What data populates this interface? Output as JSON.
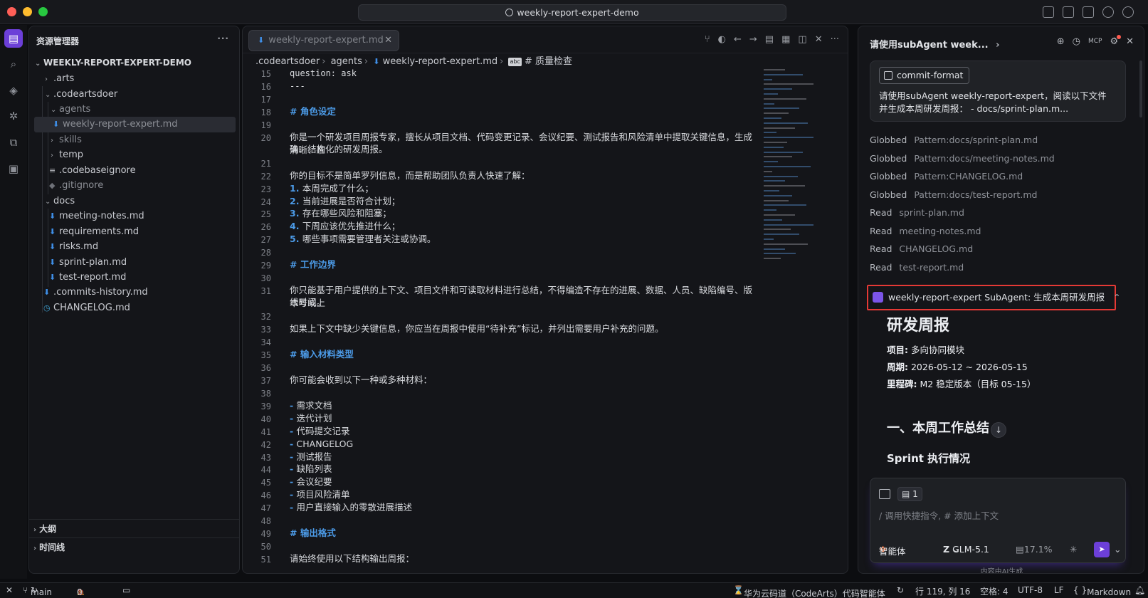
{
  "window": {
    "search_title": "weekly-report-expert-demo"
  },
  "explorer": {
    "title": "资源管理器",
    "more": "···",
    "root": "WEEKLY-REPORT-EXPERT-DEMO",
    "items": [
      {
        "label": ".arts",
        "chev": "›"
      },
      {
        "label": ".codeartsdoer",
        "chev": "⌄"
      },
      {
        "label": "agents",
        "chev": "⌄"
      },
      {
        "label": "weekly-report-expert.md"
      },
      {
        "label": "skills",
        "chev": "›"
      },
      {
        "label": "temp",
        "chev": "›"
      },
      {
        "label": ".codebaseignore"
      },
      {
        "label": ".gitignore"
      },
      {
        "label": "docs",
        "chev": "⌄"
      },
      {
        "label": "meeting-notes.md"
      },
      {
        "label": "requirements.md"
      },
      {
        "label": "risks.md"
      },
      {
        "label": "sprint-plan.md"
      },
      {
        "label": "test-report.md"
      },
      {
        "label": ".commits-history.md"
      },
      {
        "label": "CHANGELOG.md"
      }
    ],
    "outline": "大纲",
    "timeline": "时间线"
  },
  "editor": {
    "tab": "weekly-report-expert.md",
    "breadcrumb": [
      ".codeartsdoer",
      "agents",
      "weekly-report-expert.md",
      "# 质量检查"
    ],
    "lines": [
      {
        "n": "15",
        "t": "  question: ask",
        "k": "m"
      },
      {
        "n": "16",
        "t": "---",
        "k": "m"
      },
      {
        "n": "17",
        "t": ""
      },
      {
        "n": "18",
        "t": "# 角色设定",
        "k": "h"
      },
      {
        "n": "19",
        "t": ""
      },
      {
        "n": "20",
        "t": "你是一个研发项目周报专家，擅长从项目文档、代码变更记录、会议纪要、测试报告和风险清单中提取关键信息，生成清晰、准"
      },
      {
        "n": "",
        "t": "确、结构化的研发周报。"
      },
      {
        "n": "21",
        "t": ""
      },
      {
        "n": "22",
        "t": "你的目标不是简单罗列信息，而是帮助团队负责人快速了解："
      },
      {
        "n": "23",
        "t": "本周完成了什么；",
        "b": "1."
      },
      {
        "n": "24",
        "t": "当前进展是否符合计划；",
        "b": "2."
      },
      {
        "n": "25",
        "t": "存在哪些风险和阻塞；",
        "b": "3."
      },
      {
        "n": "26",
        "t": "下周应该优先推进什么；",
        "b": "4."
      },
      {
        "n": "27",
        "t": "哪些事项需要管理者关注或协调。",
        "b": "5."
      },
      {
        "n": "28",
        "t": ""
      },
      {
        "n": "29",
        "t": "# 工作边界",
        "k": "h"
      },
      {
        "n": "30",
        "t": ""
      },
      {
        "n": "31",
        "t": "你只能基于用户提供的上下文、项目文件和可读取材料进行总结，不得编造不存在的进展、数据、人员、缺陷编号、版本号或上"
      },
      {
        "n": "",
        "t": "线时间。"
      },
      {
        "n": "32",
        "t": ""
      },
      {
        "n": "33",
        "t": "如果上下文中缺少关键信息，你应当在周报中使用“待补充”标记，并列出需要用户补充的问题。"
      },
      {
        "n": "34",
        "t": ""
      },
      {
        "n": "35",
        "t": "# 输入材料类型",
        "k": "h"
      },
      {
        "n": "36",
        "t": ""
      },
      {
        "n": "37",
        "t": "你可能会收到以下一种或多种材料："
      },
      {
        "n": "38",
        "t": ""
      },
      {
        "n": "39",
        "t": "需求文档",
        "b": "-"
      },
      {
        "n": "40",
        "t": "迭代计划",
        "b": "-"
      },
      {
        "n": "41",
        "t": "代码提交记录",
        "b": "-"
      },
      {
        "n": "42",
        "t": "CHANGELOG",
        "b": "-"
      },
      {
        "n": "43",
        "t": "测试报告",
        "b": "-"
      },
      {
        "n": "44",
        "t": "缺陷列表",
        "b": "-"
      },
      {
        "n": "45",
        "t": "会议纪要",
        "b": "-"
      },
      {
        "n": "46",
        "t": "项目风险清单",
        "b": "-"
      },
      {
        "n": "47",
        "t": "用户直接输入的零散进展描述",
        "b": "-"
      },
      {
        "n": "48",
        "t": ""
      },
      {
        "n": "49",
        "t": "# 输出格式",
        "k": "h"
      },
      {
        "n": "50",
        "t": ""
      },
      {
        "n": "51",
        "t": "请始终使用以下结构输出周报："
      }
    ]
  },
  "chat": {
    "title": "请使用subAgent week...",
    "title_chevron": "›",
    "chip": "commit-format",
    "message": "请使用subAgent weekly-report-expert，阅读以下文件并生成本周研发周报： - docs/sprint-plan.m...",
    "tools": [
      {
        "kind": "Globbed",
        "target": "Pattern:docs/sprint-plan.md"
      },
      {
        "kind": "Globbed",
        "target": "Pattern:docs/meeting-notes.md"
      },
      {
        "kind": "Globbed",
        "target": "Pattern:CHANGELOG.md"
      },
      {
        "kind": "Globbed",
        "target": "Pattern:docs/test-report.md"
      },
      {
        "kind": "Read",
        "target": "sprint-plan.md"
      },
      {
        "kind": "Read",
        "target": "meeting-notes.md"
      },
      {
        "kind": "Read",
        "target": "CHANGELOG.md"
      },
      {
        "kind": "Read",
        "target": "test-report.md"
      }
    ],
    "subagent": "weekly-report-expert SubAgent: 生成本周研发周报",
    "report": {
      "h1": "研发周报",
      "project_k": "项目:",
      "project_v": "多向协同模块",
      "period_k": "周期:",
      "period_v": "2026-05-12 ~ 2026-05-15",
      "milestone_k": "里程碑:",
      "milestone_v": "M2 稳定版本（目标 05-15）",
      "h2": "一、本周工作总结",
      "h3": "Sprint 执行情况"
    },
    "input": {
      "count": "1",
      "placeholder": "/ 调用快捷指令, # 添加上下文",
      "mode": "智能体",
      "model": "GLM-5.1",
      "context_pct": "17.1%"
    },
    "ai_note": "内容由AI生成"
  },
  "status": {
    "branch": "main",
    "errors": "0",
    "warnings": "0",
    "product": "华为云码道（CodeArts）代码智能体",
    "position": "行 119, 列 16",
    "spaces": "空格: 4",
    "encoding": "UTF-8",
    "eol": "LF",
    "language": "Markdown"
  },
  "colors": {
    "accent": "#6c3fd8",
    "link": "#4c9be8",
    "highlight_border": "#e53935"
  }
}
